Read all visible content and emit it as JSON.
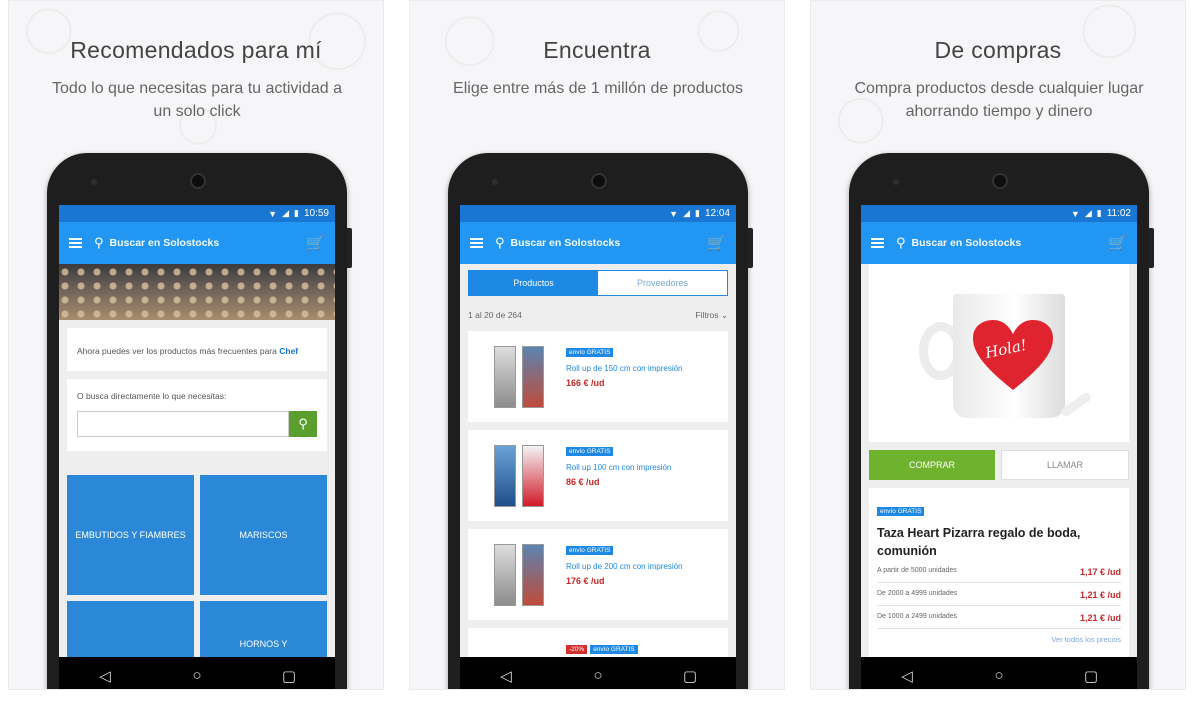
{
  "panels": [
    {
      "title": "Recomendados para mí",
      "subtitle": "Todo lo que necesitas para tu actividad a un solo click",
      "time": "10:59",
      "search_placeholder": "Buscar en Solostocks",
      "intro_text": "Ahora puedes ver los productos más frecuentes para ",
      "intro_link": "Chef",
      "search_prompt": "O busca directamente lo que necesitas:",
      "categories": [
        "EMBUTIDOS Y FIAMBRES",
        "MARISCOS",
        "",
        "HORNOS Y"
      ]
    },
    {
      "title": "Encuentra",
      "subtitle": "Elige entre más de 1 millón de productos",
      "time": "12:04",
      "search_placeholder": "Buscar en Solostocks",
      "tabs": [
        "Productos",
        "Proveedores"
      ],
      "results_count": "1 al 20 de 264",
      "filters_label": "Filtros",
      "products": [
        {
          "badge": "envío GRATIS",
          "name": "Roll up de 150 cm con impresión",
          "price": "166 € /ud"
        },
        {
          "badge": "envío GRATIS",
          "name": "Roll up 100 cm con impresión",
          "price": "86 € /ud"
        },
        {
          "badge": "envío GRATIS",
          "name": "Roll up de 200 cm con impresión",
          "price": "176 € /ud"
        }
      ],
      "partial_badges": [
        "-20%",
        "envío GRATIS"
      ]
    },
    {
      "title": "De compras",
      "subtitle": "Compra productos desde cualquier lugar ahorrando tiempo y dinero",
      "time": "11:02",
      "search_placeholder": "Buscar en Solostocks",
      "mug_text": "Hola!",
      "buy_label": "COMPRAR",
      "call_label": "LLAMAR",
      "badge": "envío GRATIS",
      "product_title": "Taza Heart Pizarra regalo de boda, comunión",
      "price_rows": [
        {
          "label": "A partir de 5000 unidades",
          "value": "1,17 € /ud"
        },
        {
          "label": "De 2000 a 4999 unidades",
          "value": "1,21 € /ud"
        },
        {
          "label": "De 1000 a 2499 unidades",
          "value": "1,21 € /ud"
        }
      ],
      "see_all": "Ver todos los precios"
    }
  ],
  "colors": {
    "status_bar": "#1976d2",
    "app_bar": "#2196f3",
    "accent_green": "#6fb22e",
    "price_red": "#c62828"
  },
  "icons": [
    "menu-icon",
    "search-icon",
    "cart-icon",
    "wifi-icon",
    "signal-icon",
    "battery-icon",
    "back-icon",
    "home-icon",
    "recents-icon"
  ]
}
